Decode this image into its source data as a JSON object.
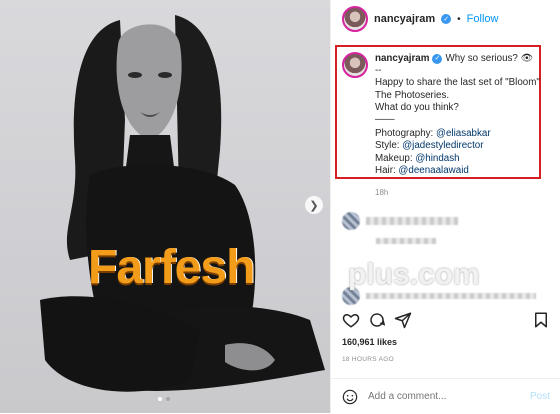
{
  "post": {
    "username": "nancyajram",
    "follow_label": "Follow",
    "verified_glyph": "✓",
    "caption_lines": [
      "Why so serious? 👁",
      "--",
      "Happy to share the last set of \"Bloom\"",
      "The Photoseries.",
      "What do you think?",
      "——"
    ],
    "credits": [
      {
        "label": "Photography: ",
        "handle": "@eliasabkar"
      },
      {
        "label": "Style: ",
        "handle": "@jadestyledirector"
      },
      {
        "label": "Makeup: ",
        "handle": "@hindash"
      },
      {
        "label": "Hair: ",
        "handle": "@deenaalawaid"
      }
    ],
    "caption_time": "18h",
    "likes": "160,961 likes",
    "time_ago": "18 HOURS AGO",
    "comment_placeholder": "Add a comment...",
    "post_label": "Post"
  },
  "watermark": {
    "main": "Farfesh",
    "suffix": "plus.com"
  },
  "colors": {
    "accent": "#0095f6",
    "highlight_border": "#d61e25",
    "watermark": "#f39c1a"
  }
}
